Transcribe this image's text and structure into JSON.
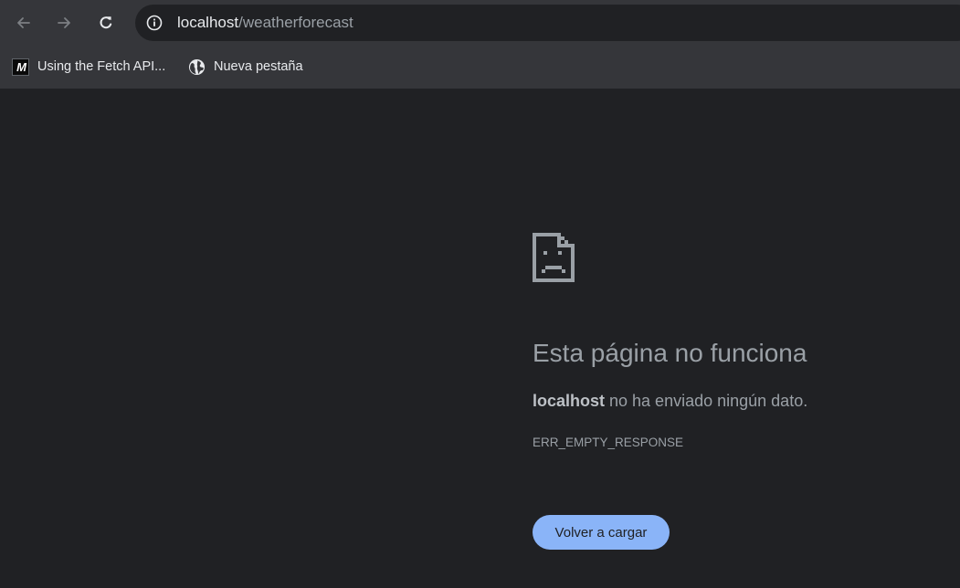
{
  "browser": {
    "nav": {
      "back_icon": "arrow-left-icon",
      "forward_icon": "arrow-right-icon",
      "reload_icon": "reload-icon"
    },
    "omnibox": {
      "info_icon": "info-icon",
      "host": "localhost",
      "path": "/weatherforecast"
    },
    "bookmarks": [
      {
        "label": "Using the Fetch API...",
        "icon": "mdn-logo-icon"
      },
      {
        "label": "Nueva pestaña",
        "icon": "globe-icon"
      }
    ]
  },
  "error_page": {
    "icon": "sad-page-icon",
    "title": "Esta página no funciona",
    "host": "localhost",
    "description_rest": " no ha enviado ningún dato.",
    "code": "ERR_EMPTY_RESPONSE",
    "reload_label": "Volver a cargar"
  },
  "colors": {
    "background": "#202124",
    "toolbar": "#35363a",
    "accent": "#8ab4f8",
    "muted_text": "#9aa0a6"
  }
}
